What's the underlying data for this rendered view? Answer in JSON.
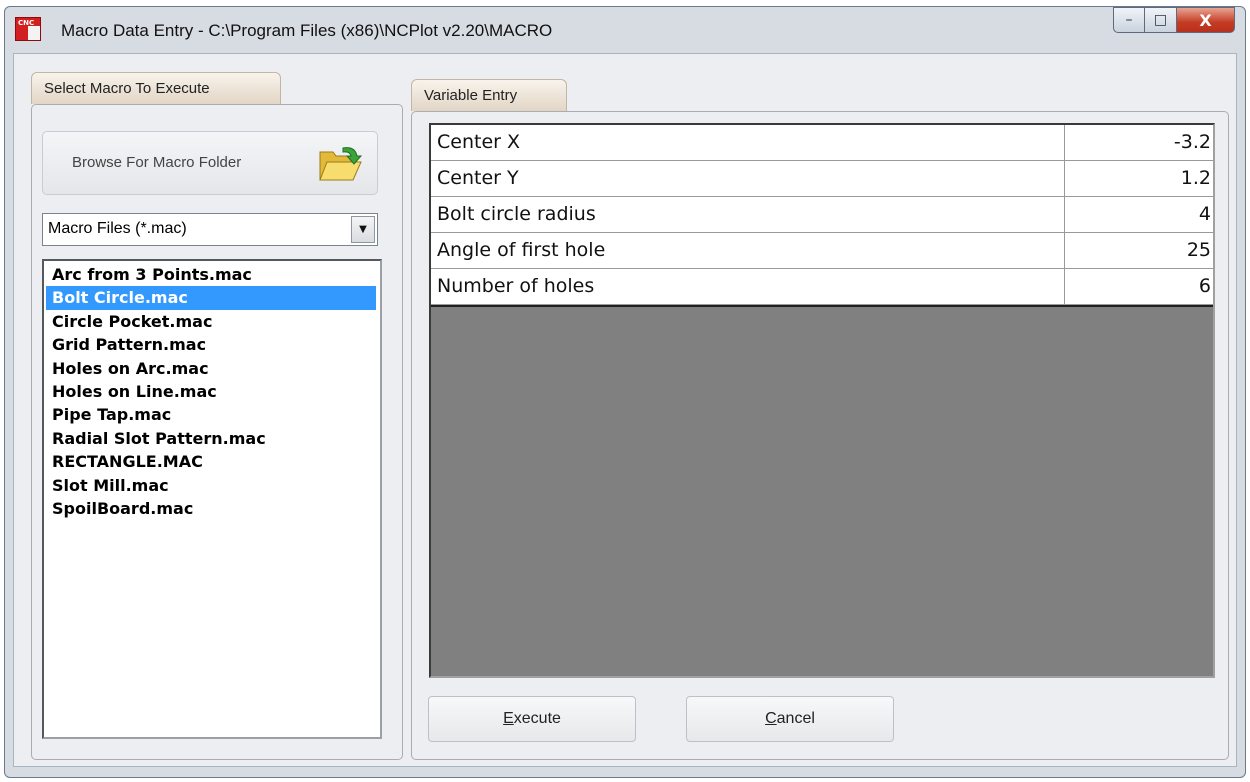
{
  "window": {
    "title": "Macro Data Entry - C:\\Program Files (x86)\\NCPlot v2.20\\MACRO",
    "app_icon_text": "CNC",
    "min_glyph": "–",
    "max_glyph": "□",
    "close_glyph": "X"
  },
  "left_panel": {
    "tab_label": "Select Macro To Execute",
    "browse_button_label": "Browse For Macro Folder",
    "filter_select_value": "Macro Files (*.mac)",
    "files": [
      "Arc from 3 Points.mac",
      "Bolt Circle.mac",
      "Circle Pocket.mac",
      "Grid Pattern.mac",
      "Holes on Arc.mac",
      "Holes on Line.mac",
      "Pipe Tap.mac",
      "Radial Slot Pattern.mac",
      "RECTANGLE.MAC",
      "Slot Mill.mac",
      "SpoilBoard.mac"
    ],
    "selected_file": "Bolt Circle.mac"
  },
  "right_panel": {
    "tab_label": "Variable Entry",
    "variables": [
      {
        "name": "Center X",
        "value": "-3.2"
      },
      {
        "name": "Center Y",
        "value": "1.2"
      },
      {
        "name": "Bolt circle radius",
        "value": "4"
      },
      {
        "name": "Angle of first hole",
        "value": "25"
      },
      {
        "name": "Number of holes",
        "value": "6"
      }
    ],
    "execute_mnemonic": "E",
    "execute_rest": "xecute",
    "cancel_mnemonic": "C",
    "cancel_rest": "ancel"
  },
  "colors": {
    "selection": "#3399ff",
    "grid_empty": "#808080",
    "close_button": "#c43b22"
  }
}
